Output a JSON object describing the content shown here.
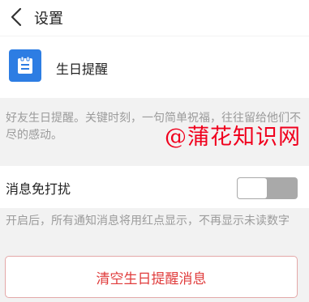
{
  "header": {
    "back_icon": "chevron-left-icon",
    "title": "设置"
  },
  "feature": {
    "icon": "notepad-icon",
    "icon_color": "#2d7de3",
    "label": "生日提醒",
    "description": "好友生日提醒。关键时刻，一句简单祝福，往往留给他们不尽的感动。"
  },
  "do_not_disturb": {
    "label": "消息免打扰",
    "enabled": false,
    "hint": "开启后，所有通知消息将用红点显示，不再显示未读数字"
  },
  "actions": {
    "clear_label": "清空生日提醒消息",
    "clear_color": "#e03c3c"
  },
  "watermark": {
    "text": "@蒲花知识网",
    "color": "#f0001d"
  }
}
